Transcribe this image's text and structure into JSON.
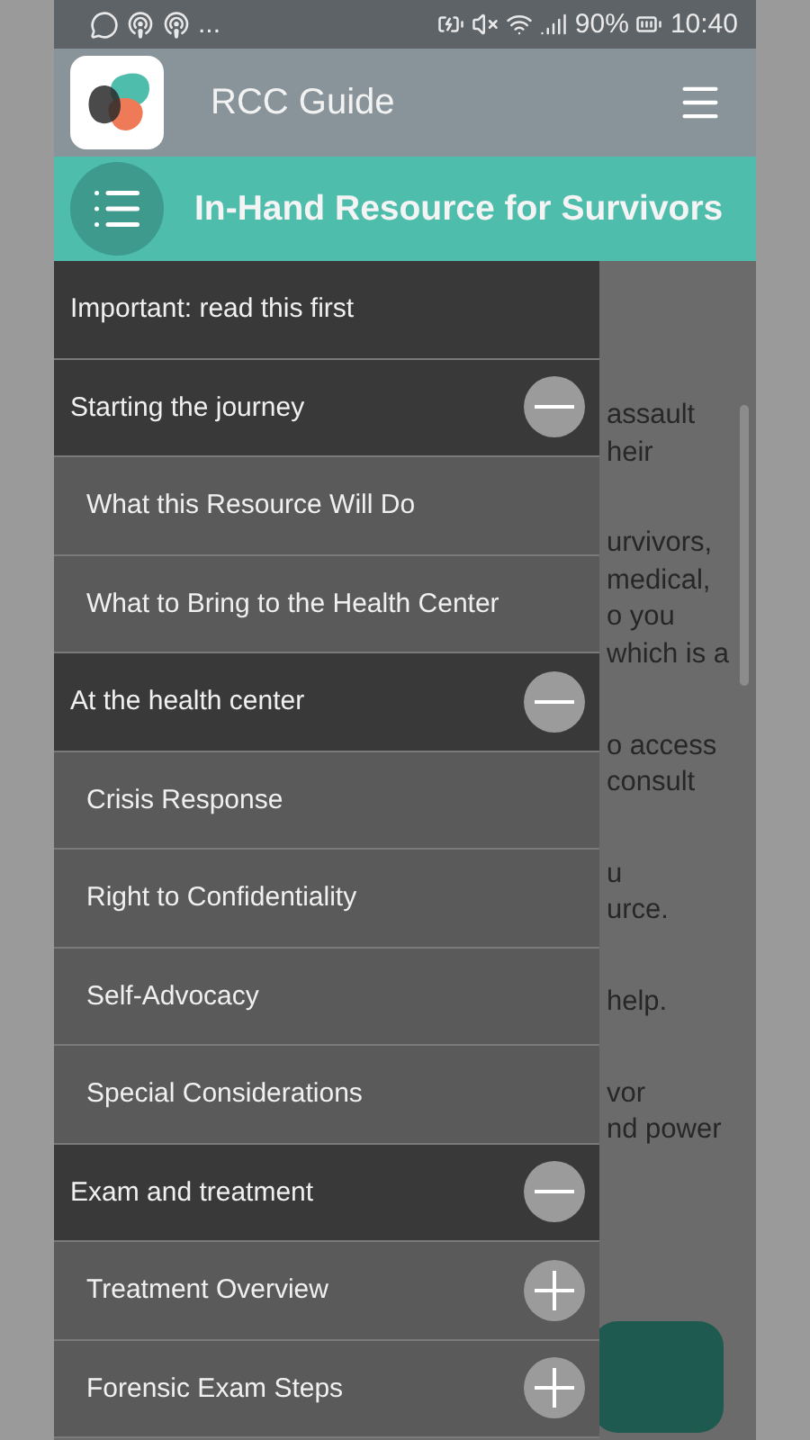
{
  "status_bar": {
    "left_more": "...",
    "battery_percent": "90%",
    "time": "10:40"
  },
  "app_bar": {
    "title": "RCC Guide"
  },
  "header": {
    "title": "In-Hand Resource for Survivors"
  },
  "menu": [
    {
      "label": "Important: read this first"
    },
    {
      "label": "Starting the journey",
      "expanded": true,
      "children": [
        {
          "label": "What this Resource Will Do"
        },
        {
          "label": "What to Bring to the Health Center"
        }
      ]
    },
    {
      "label": "At the health center",
      "expanded": true,
      "children": [
        {
          "label": "Crisis Response"
        },
        {
          "label": "Right to Confidentiality"
        },
        {
          "label": "Self-Advocacy"
        },
        {
          "label": "Special Considerations"
        }
      ]
    },
    {
      "label": "Exam and treatment",
      "expanded": true,
      "children": [
        {
          "label": "Treatment Overview",
          "expanded": false
        },
        {
          "label": "Forensic Exam Steps",
          "expanded": false
        }
      ]
    }
  ],
  "content": {
    "paragraphs": [
      [
        "assault",
        "heir"
      ],
      [
        "urvivors,",
        "medical,",
        "o you",
        "which is a"
      ],
      [
        "o access",
        "consult"
      ],
      [
        "u",
        "urce."
      ],
      [
        "help."
      ],
      [
        "vor",
        "nd power"
      ]
    ]
  }
}
